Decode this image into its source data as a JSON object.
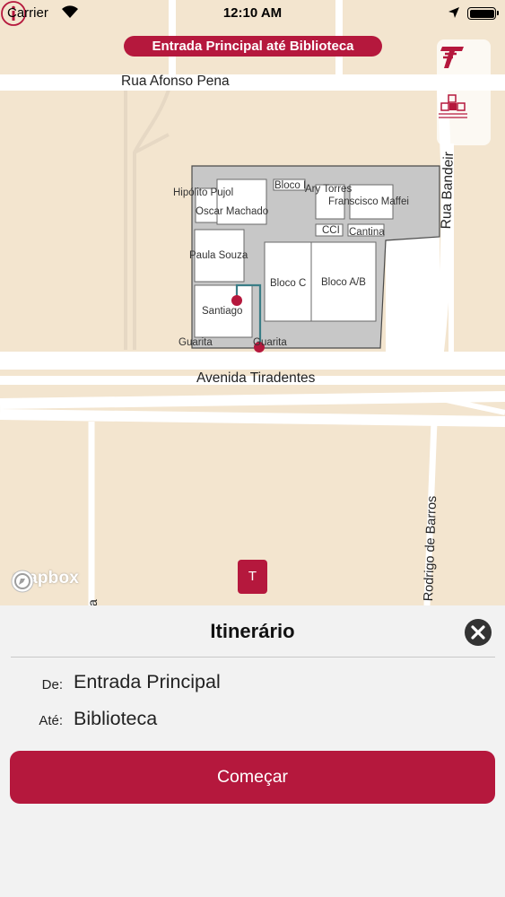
{
  "status_bar": {
    "carrier": "Carrier",
    "time": "12:10 AM"
  },
  "map": {
    "route_banner": "Entrada Principal até Biblioteca",
    "streets": {
      "rua_afonso_pena": "Rua Afonso Pena",
      "avenida_tiradentes": "Avenida Tiradentes",
      "rua_bandeira": "Rua Bandeir",
      "rodrigo_de_barros": "Rodrigo de Barros",
      "bottom_left_fragment": "a"
    },
    "buildings": {
      "hipolito_pujol": "Hipólito Pujol",
      "oscar_machado": "Oscar Machado",
      "bloco_i": "Bloco I",
      "ary_torres": "Ary Torres",
      "francisco_maffei": "Franscisco Maffei",
      "cci": "CCI",
      "cantina": "Cantina",
      "paula_souza": "Paula Souza",
      "bloco_c": "Bloco C",
      "bloco_ab": "Bloco A/B",
      "santiago": "Santiago",
      "guarita_left": "Guarita",
      "guarita_right": "Guarita"
    },
    "attribution": "mapbox",
    "center_marker": "T",
    "accent_color": "#b5183d"
  },
  "panel": {
    "title": "Itinerário",
    "from_label": "De:",
    "from_value": "Entrada Principal",
    "to_label": "Até:",
    "to_value": "Biblioteca",
    "start_button": "Começar"
  }
}
